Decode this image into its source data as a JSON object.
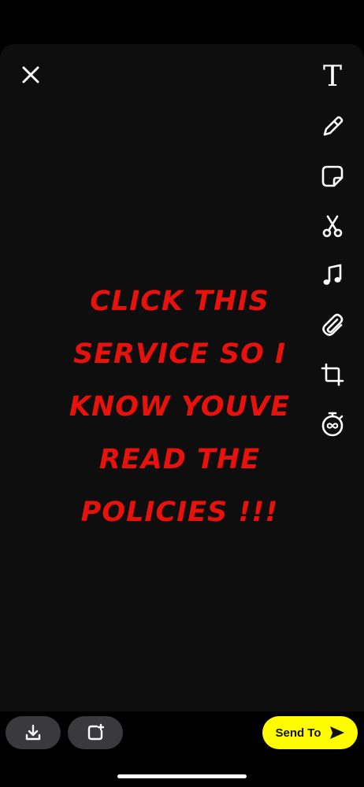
{
  "toolbar": {
    "text_tool_glyph": "T",
    "icons": [
      "text-icon",
      "pencil-icon",
      "sticker-icon",
      "scissors-icon",
      "music-note-icon",
      "paperclip-icon",
      "crop-icon",
      "timer-icon"
    ]
  },
  "caption": {
    "lines": [
      "CLICK THIS",
      "SERVICE SO I",
      "KNOW YOUVE",
      "READ THE",
      "POLICIES !!!"
    ],
    "color": "#e8120c"
  },
  "footer": {
    "send_label": "Send To",
    "send_color": "#fffc00",
    "pill_color": "#3a3a3c"
  }
}
